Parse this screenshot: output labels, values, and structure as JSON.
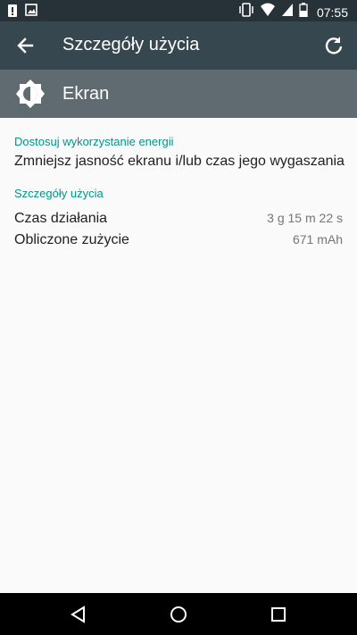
{
  "status_bar": {
    "time": "07:55",
    "left_icons": [
      "alert-icon",
      "image-icon"
    ],
    "right_icons": [
      "vibrate-icon",
      "wifi-icon",
      "signal-icon",
      "battery-icon"
    ]
  },
  "app_bar": {
    "title": "Szczegóły użycia",
    "back_icon": "arrow-back-icon",
    "refresh_icon": "refresh-icon"
  },
  "header": {
    "icon": "brightness-icon",
    "title": "Ekran"
  },
  "sections": {
    "energy": {
      "title": "Dostosuj wykorzystanie energii",
      "item": "Zmniejsz jasność ekranu i/lub czas jego wygaszania"
    },
    "usage": {
      "title": "Szczegóły użycia",
      "rows": [
        {
          "label": "Czas działania",
          "value": "3 g 15 m 22 s"
        },
        {
          "label": "Obliczone zużycie",
          "value": "671 mAh"
        }
      ]
    }
  },
  "colors": {
    "status_bar": "#263238",
    "app_bar": "#37474f",
    "header_band": "#5f6b70",
    "accent": "#009688",
    "background": "#fafafa"
  },
  "nav_bar": {
    "buttons": [
      "back-triangle-icon",
      "home-circle-icon",
      "recents-square-icon"
    ]
  }
}
